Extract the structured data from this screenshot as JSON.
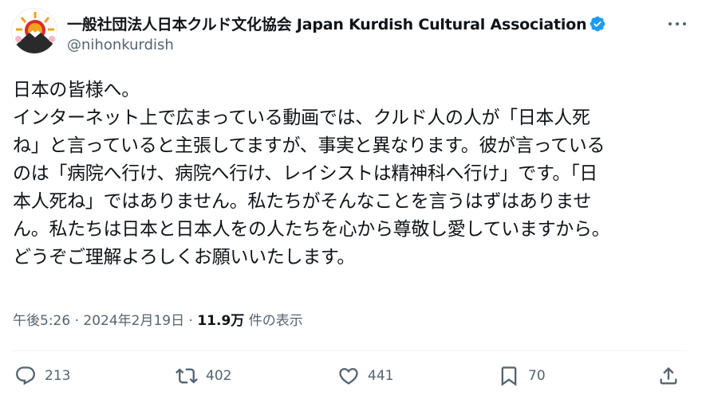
{
  "account": {
    "display_name": "一般社団法人日本クルド文化協会 Japan Kurdish Cultural Association",
    "handle": "@nihonkurdish"
  },
  "post": {
    "text": "日本の皆様へ。\nインターネット上で広まっている動画では、クルド人の人が「日本人死\nね」と言っていると主張してますが、事実と異なります。彼が言っている\nのは「病院へ行け、病院へ行け、レイシストは精神科へ行け」です。「日\n本人死ね」ではありません。私たちがそんなことを言うはずはありませ\nん。私たちは日本と日本人をの人たちを心から尊敬し愛していますから。\nどうぞご理解よろしくお願いいたします。",
    "time": "午後5:26",
    "separator": "·",
    "date": "2024年2月19日",
    "views": "11.9万",
    "views_label": "件の表示"
  },
  "actions": {
    "replies": "213",
    "reposts": "402",
    "likes": "441",
    "bookmarks": "70"
  },
  "colors": {
    "text": "#0f1419",
    "secondary": "#536471",
    "verified": "#1d9bf0",
    "avatar_sun": "#f2a31b",
    "avatar_ring": "#d92b2b"
  }
}
